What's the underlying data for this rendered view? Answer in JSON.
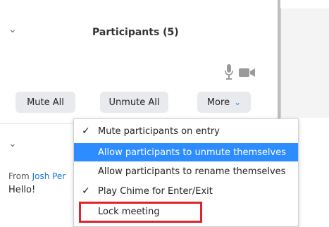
{
  "participants": {
    "title": "Participants (5)",
    "buttons": {
      "mute_all": "Mute All",
      "unmute_all": "Unmute All",
      "more": "More"
    }
  },
  "chat": {
    "from_prefix": "From",
    "sender": "Josh Per",
    "message": "Hello!"
  },
  "menu": {
    "items": [
      {
        "label": "Mute participants on entry",
        "checked": true,
        "selected": false
      },
      {
        "label": "Allow participants to unmute themselves",
        "checked": false,
        "selected": true
      },
      {
        "label": "Allow participants to rename themselves",
        "checked": false,
        "selected": false
      },
      {
        "label": "Play Chime for Enter/Exit",
        "checked": true,
        "selected": false
      },
      {
        "label": "Lock meeting",
        "checked": false,
        "selected": false,
        "annotated": true
      }
    ]
  },
  "colors": {
    "selected": "#2d8cff",
    "annotation": "#e0222b",
    "link": "#1a73e8"
  },
  "icons": {
    "check": "✓",
    "chevron": "⌄",
    "more_chevron": "⌄"
  }
}
